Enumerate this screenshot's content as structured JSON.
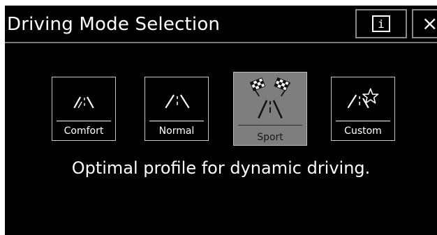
{
  "header": {
    "title": "Driving Mode Selection",
    "info_button": {
      "icon": "info-icon",
      "glyph": "i"
    },
    "close_button": {
      "icon": "close-icon",
      "glyph": "×"
    }
  },
  "modes": [
    {
      "id": "comfort",
      "label": "Comfort",
      "icon": "road-comfort-icon",
      "selected": false
    },
    {
      "id": "normal",
      "label": "Normal",
      "icon": "road-normal-icon",
      "selected": false
    },
    {
      "id": "sport",
      "label": "Sport",
      "icon": "road-sport-checkered-flags-icon",
      "selected": true
    },
    {
      "id": "custom",
      "label": "Custom",
      "icon": "road-custom-star-icon",
      "selected": false
    }
  ],
  "description": "Optimal profile for dynamic driving.",
  "colors": {
    "background": "#000000",
    "text": "#ffffff",
    "border": "#c9c9c9",
    "selected_fill": "#7e7e7e",
    "selected_text": "#1a1a1a"
  }
}
